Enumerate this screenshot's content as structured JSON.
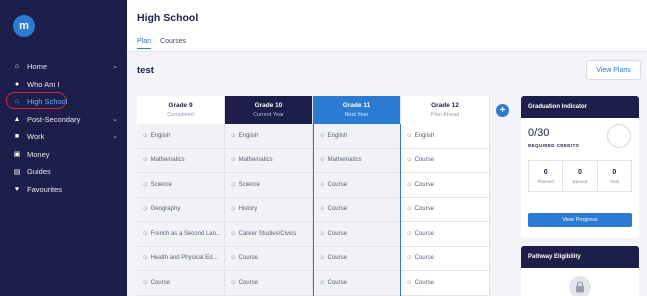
{
  "app": {
    "logo_letter": "m"
  },
  "sidebar": {
    "items": [
      {
        "label": "Home",
        "icon": "home-icon",
        "glyph": "⌂",
        "chevron": "⌄",
        "active": false
      },
      {
        "label": "Who Am I",
        "icon": "user-icon",
        "glyph": "●",
        "chevron": "",
        "active": false
      },
      {
        "label": "High School",
        "icon": "school-icon",
        "glyph": "⌂",
        "chevron": "",
        "active": true
      },
      {
        "label": "Post-Secondary",
        "icon": "graduation-cap-icon",
        "glyph": "▲",
        "chevron": "⌄",
        "active": false
      },
      {
        "label": "Work",
        "icon": "briefcase-icon",
        "glyph": "■",
        "chevron": "⌄",
        "active": false
      },
      {
        "label": "Money",
        "icon": "money-icon",
        "glyph": "▣",
        "chevron": "",
        "active": false
      },
      {
        "label": "Guides",
        "icon": "book-icon",
        "glyph": "▤",
        "chevron": "",
        "active": false
      },
      {
        "label": "Favourites",
        "icon": "heart-icon",
        "glyph": "♥",
        "chevron": "",
        "active": false
      }
    ]
  },
  "header": {
    "title": "High School",
    "tabs": [
      {
        "label": "Plan",
        "active": true
      },
      {
        "label": "Courses",
        "active": false
      }
    ]
  },
  "plan": {
    "name": "test",
    "view_plans_label": "View Plans"
  },
  "grades": [
    {
      "grade": "Grade 9",
      "status": "Completed",
      "courses": [
        "English",
        "Mathematics",
        "Science",
        "Geography",
        "French as a Second Lan...",
        "Health and Physical Ed...",
        "Course"
      ]
    },
    {
      "grade": "Grade 10",
      "status": "Current Year",
      "courses": [
        "English",
        "Mathematics",
        "Science",
        "History",
        "Career Studies/Civics",
        "Course",
        "Course"
      ]
    },
    {
      "grade": "Grade 11",
      "status": "Next Year",
      "courses": [
        "English",
        "Mathematics",
        "Course",
        "Course",
        "Course",
        "Course",
        "Course"
      ]
    },
    {
      "grade": "Grade 12",
      "status": "Plan Ahead",
      "courses": [
        "English",
        "Course",
        "Course",
        "Course",
        "Course",
        "Course",
        "Course"
      ]
    }
  ],
  "course_bullet": "⊙",
  "add_grade_symbol": "+",
  "graduation": {
    "title": "Graduation Indicator",
    "credits": "0/30",
    "credits_label": "REQUIRED CREDITS",
    "stats": [
      {
        "value": "0",
        "label": "Planned"
      },
      {
        "value": "0",
        "label": "Earned"
      },
      {
        "value": "0",
        "label": "Total"
      }
    ],
    "progress_button": "View Progress"
  },
  "pathway": {
    "title": "Pathway Eligibility"
  },
  "colors": {
    "sidebar_bg": "#1d1f4a",
    "accent": "#2a7bd1",
    "highlight_ring": "#d0283a"
  }
}
